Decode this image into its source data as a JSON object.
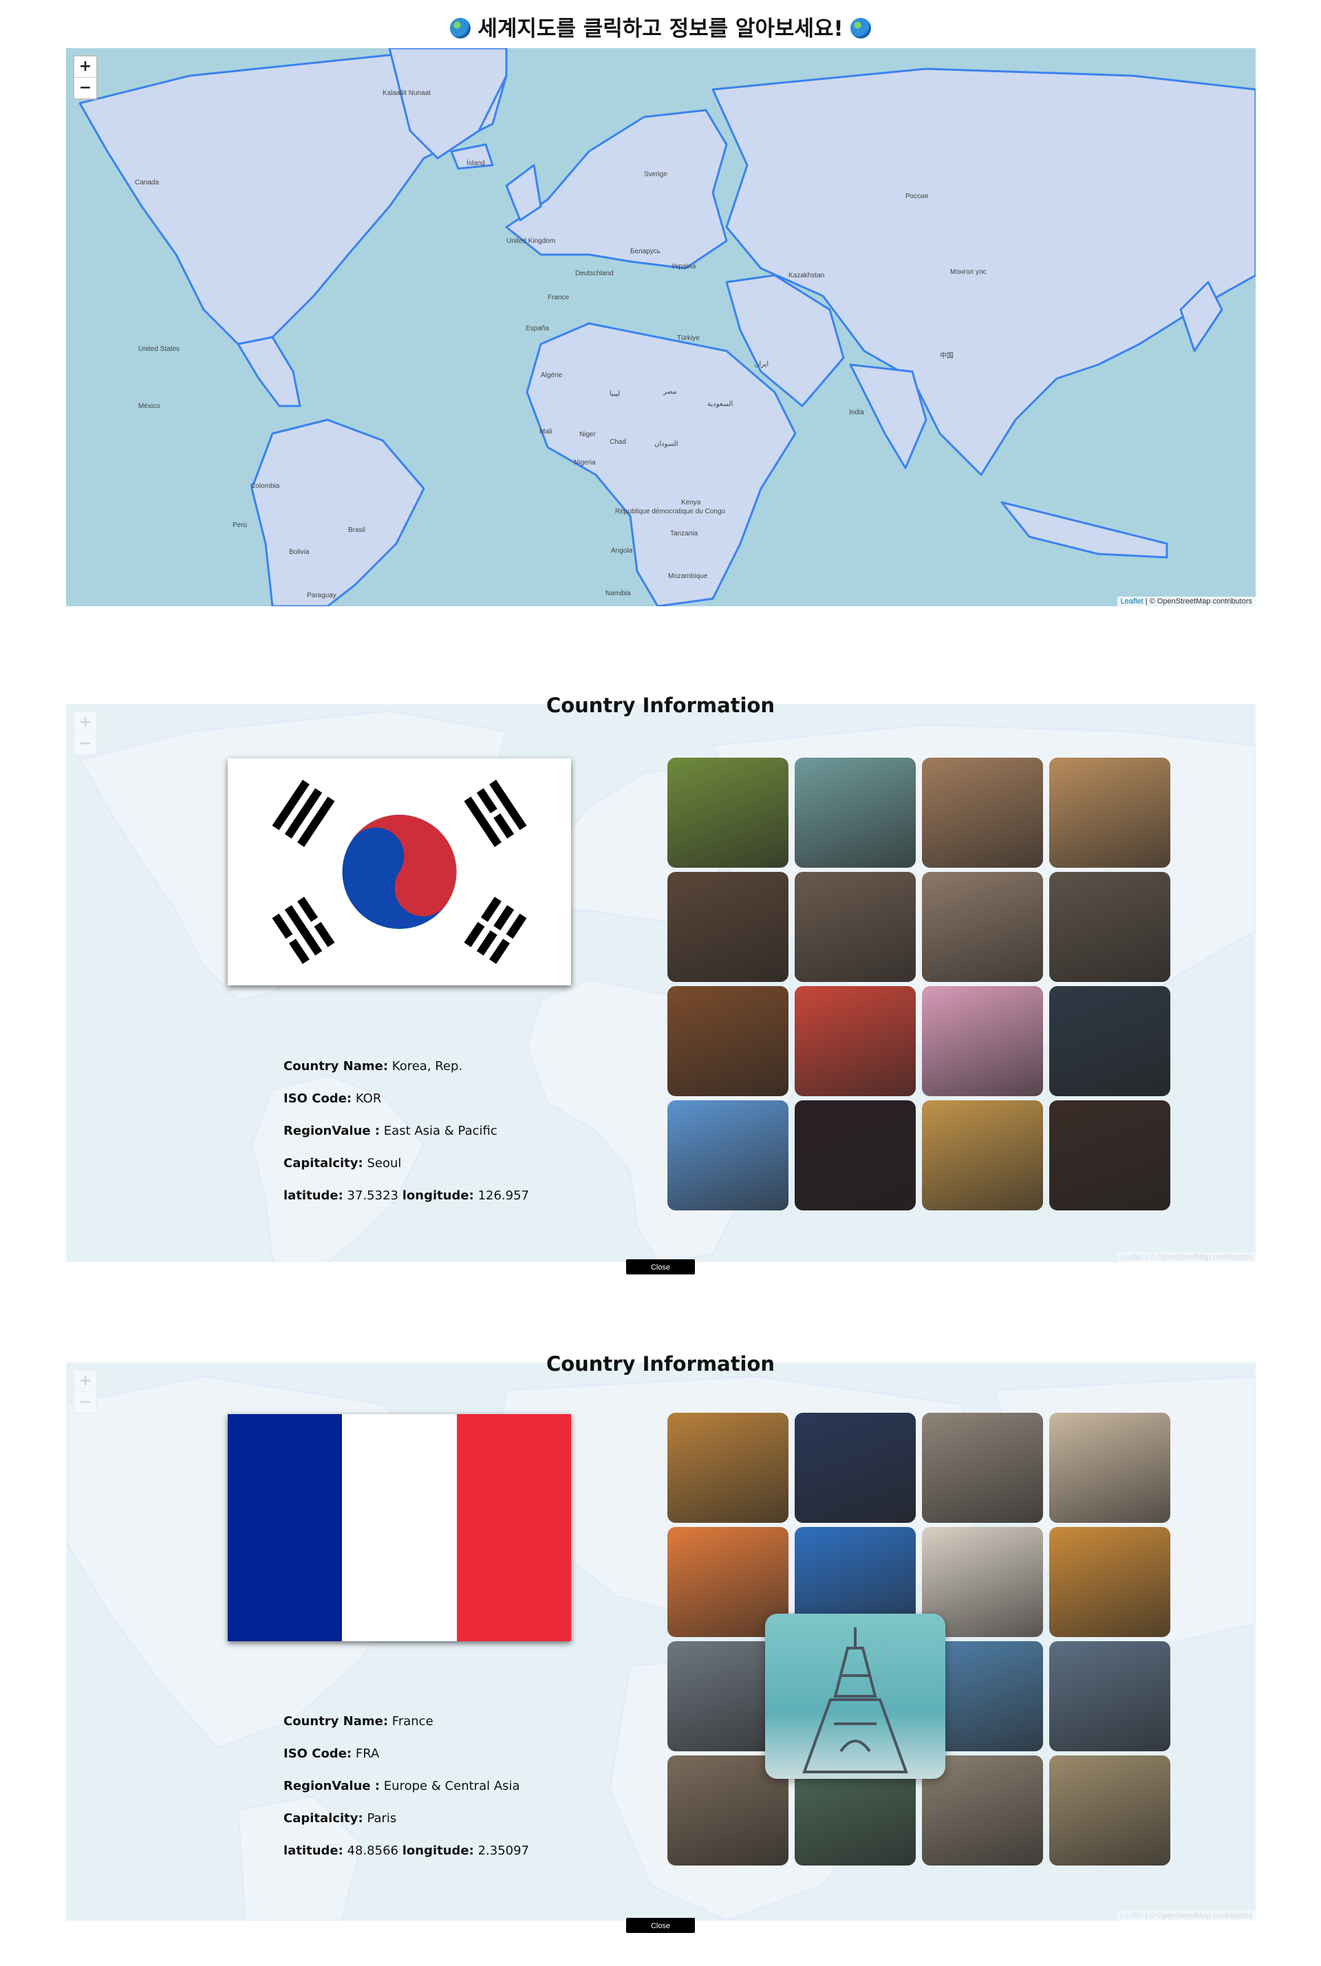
{
  "header": {
    "title": "세계지도를 클릭하고 정보를 알아보세요!"
  },
  "map": {
    "zoom_in": "+",
    "zoom_out": "−",
    "attribution_leaflet": "Leaflet",
    "attribution_rest": " | © OpenStreetMap contributors",
    "labels": [
      "Kalaallit Nunaat",
      "Canada",
      "Россия",
      "United States",
      "México",
      "Kazakhstan",
      "Монгол улс",
      "中国",
      "Україна",
      "France",
      "España",
      "Türkiye",
      "ایران",
      "India",
      "Algérie",
      "Mali",
      "Niger",
      "Chad",
      "Nigeria",
      "Colombia",
      "Brasil",
      "Bolivia",
      "Perú",
      "République démocratique du Congo",
      "Angola",
      "Kenya",
      "Tanzania",
      "Namibia",
      "Mozambique",
      "Ísland",
      "Sverige",
      "United Kingdom",
      "Deutschland",
      "Беларусь",
      "السعودية",
      "ليبيا",
      "مصر",
      "السودان",
      "Paraguay"
    ]
  },
  "panels": [
    {
      "title": "Country Information",
      "flag": "korea",
      "country_name_label": "Country Name:",
      "country_name": "Korea, Rep.",
      "iso_label": "ISO Code:",
      "iso": "KOR",
      "region_label": "RegionValue :",
      "region": "East Asia & Pacific",
      "capital_label": "Capitalcity:",
      "capital": "Seoul",
      "lat_label": "latitude:",
      "lat": "37.5323",
      "lon_label": "longitude:",
      "lon": "126.957",
      "close": "Close",
      "photos": [
        "temple-garden",
        "bare-tree-pavilion",
        "hanok-rooftops",
        "hillside-village",
        "alley-sunlight",
        "hanok-alley",
        "hanok-street-fog",
        "bukchon-street",
        "shop-doorway",
        "street-vending",
        "cosmos-flowers",
        "rainy-street-night",
        "namsan-tower",
        "neon-street",
        "windmill-field",
        "night-market"
      ],
      "photo_colors": [
        "#6f8a3c",
        "#6e9a9a",
        "#a07b5c",
        "#b88c5d",
        "#5a4638",
        "#6a5a4e",
        "#8c7868",
        "#5d5248",
        "#7a4b2c",
        "#c8463a",
        "#d79ab7",
        "#2f3a46",
        "#5c93cf",
        "#2a2024",
        "#c0934a",
        "#3a2c28"
      ]
    },
    {
      "title": "Country Information",
      "flag": "france",
      "country_name_label": "Country Name:",
      "country_name": "France",
      "iso_label": "ISO Code:",
      "iso": "FRA",
      "region_label": "RegionValue :",
      "region": "Europe & Central Asia",
      "capital_label": "Capitalcity:",
      "capital": "Paris",
      "lat_label": "latitude:",
      "lat": "48.8566",
      "lon_label": "longitude:",
      "lon": "2.35097",
      "close": "Close",
      "photos": [
        "louvre-pyramid-night",
        "eiffel-night",
        "paris-street",
        "metro-sign",
        "arc-sunset",
        "eiffel-blue-sky",
        "sacre-coeur-view",
        "croissants",
        "mont-saint-michel",
        "eiffel-tower",
        "riviera-harbour",
        "eiffel-seine",
        "arc-de-triomphe",
        "colmar-canal",
        "notre-dame",
        "eiffel-river"
      ],
      "photo_colors": [
        "#b7803c",
        "#2a3858",
        "#8e8478",
        "#c9b79f",
        "#e07a3c",
        "#2f6fbf",
        "#d8d0c4",
        "#c98a3a",
        "#6e7680",
        "#9aa6b8",
        "#4f7fa8",
        "#5b6e82",
        "#7a6a5a",
        "#4e6a5a",
        "#8a7e70",
        "#9b8a6a"
      ],
      "enlarged_photo": "eiffel-tower-enlarged"
    }
  ]
}
